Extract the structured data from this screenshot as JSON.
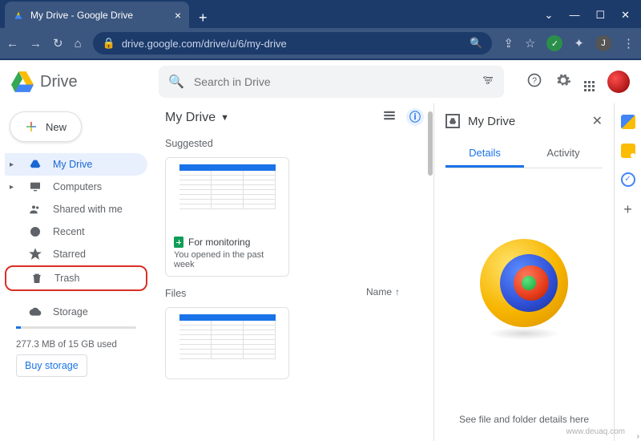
{
  "browser": {
    "tab_title": "My Drive - Google Drive",
    "url": "drive.google.com/drive/u/6/my-drive",
    "avatar_letter": "J"
  },
  "header": {
    "product": "Drive",
    "search_placeholder": "Search in Drive"
  },
  "sidebar": {
    "new_label": "New",
    "items": [
      {
        "label": "My Drive"
      },
      {
        "label": "Computers"
      },
      {
        "label": "Shared with me"
      },
      {
        "label": "Recent"
      },
      {
        "label": "Starred"
      },
      {
        "label": "Trash"
      }
    ],
    "storage_label": "Storage",
    "storage_used": "277.3 MB of 15 GB used",
    "buy_label": "Buy storage"
  },
  "main": {
    "breadcrumb": "My Drive",
    "suggested_label": "Suggested",
    "files_label": "Files",
    "sort_label": "Name",
    "suggested_card": {
      "title": "For monitoring",
      "subtitle": "You opened in the past week"
    }
  },
  "details": {
    "title": "My Drive",
    "tab_details": "Details",
    "tab_activity": "Activity",
    "message": "See file and folder details here"
  },
  "watermark": "www.deuaq.com"
}
